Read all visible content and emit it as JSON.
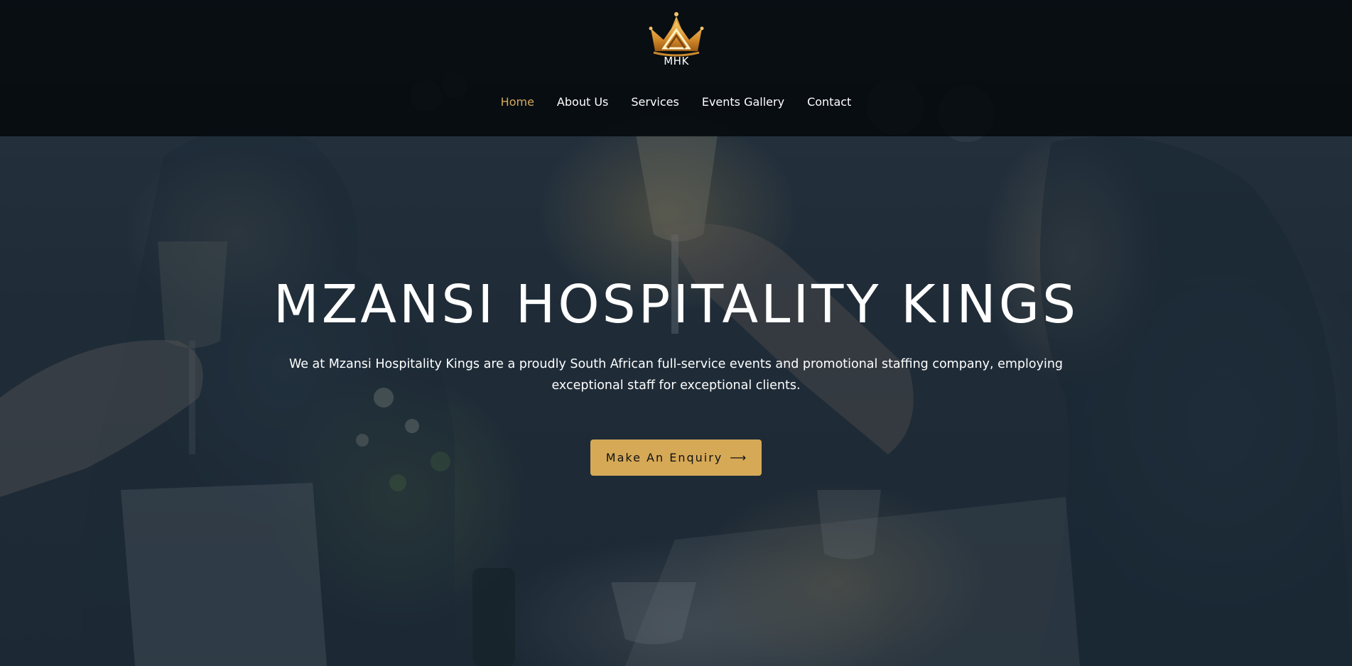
{
  "brand": {
    "logo_text": "MHK",
    "accent_color": "#d6a957"
  },
  "nav": {
    "items": [
      {
        "label": "Home",
        "active": true
      },
      {
        "label": "About Us",
        "active": false
      },
      {
        "label": "Services",
        "active": false
      },
      {
        "label": "Events Gallery",
        "active": false
      },
      {
        "label": "Contact",
        "active": false
      }
    ]
  },
  "hero": {
    "title": "MZANSI HOSPITALITY KINGS",
    "description": "We at Mzansi Hospitality Kings are a proudly South African full-service events and promotional staffing company, employing exceptional staff for exceptional clients.",
    "cta_label": "Make An Enquiry",
    "cta_icon": "arrow-right-icon",
    "background_image": "people raising champagne glasses at a dinner table"
  }
}
